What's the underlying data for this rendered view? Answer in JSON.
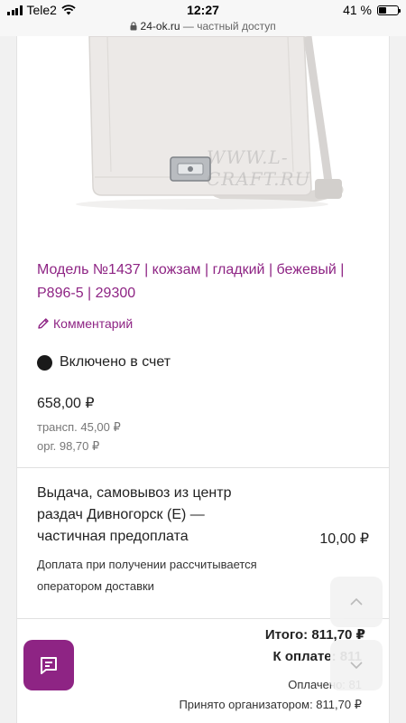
{
  "status_bar": {
    "carrier": "Tele2",
    "time": "12:27",
    "battery": "41 %",
    "battery_level": 0.41
  },
  "browser": {
    "host": "24-ok.ru",
    "privacy_note": "— частный доступ"
  },
  "product": {
    "title": "Модель №1437 | кожзам | гладкий | бежевый | P896-5 | 29300",
    "watermark": "WWW.L-CRAFT.RU",
    "comment_label": "Комментарий",
    "included_label": "Включено в счет",
    "price": "658,00 ₽",
    "transport": "трансп. 45,00 ₽",
    "org": "орг. 98,70 ₽"
  },
  "delivery": {
    "description": "Выдача, самовывоз из центр раздач Дивногорск (Е) — частичная предоплата",
    "price": "10,00 ₽",
    "note": "Доплата при получении рассчитывается оператором доставки"
  },
  "summary": {
    "total": "Итого: 811,70 ₽",
    "to_pay": "К оплате: 811",
    "paid": "Оплачено: 81",
    "accepted": "Принято организатором: 811,70 ₽"
  },
  "icons": {
    "comment": "pencil-icon",
    "chat": "chat-icon",
    "up": "chevron-up-icon",
    "down": "chevron-down-icon"
  },
  "colors": {
    "accent": "#8e2484",
    "background": "#f1f1f1"
  }
}
